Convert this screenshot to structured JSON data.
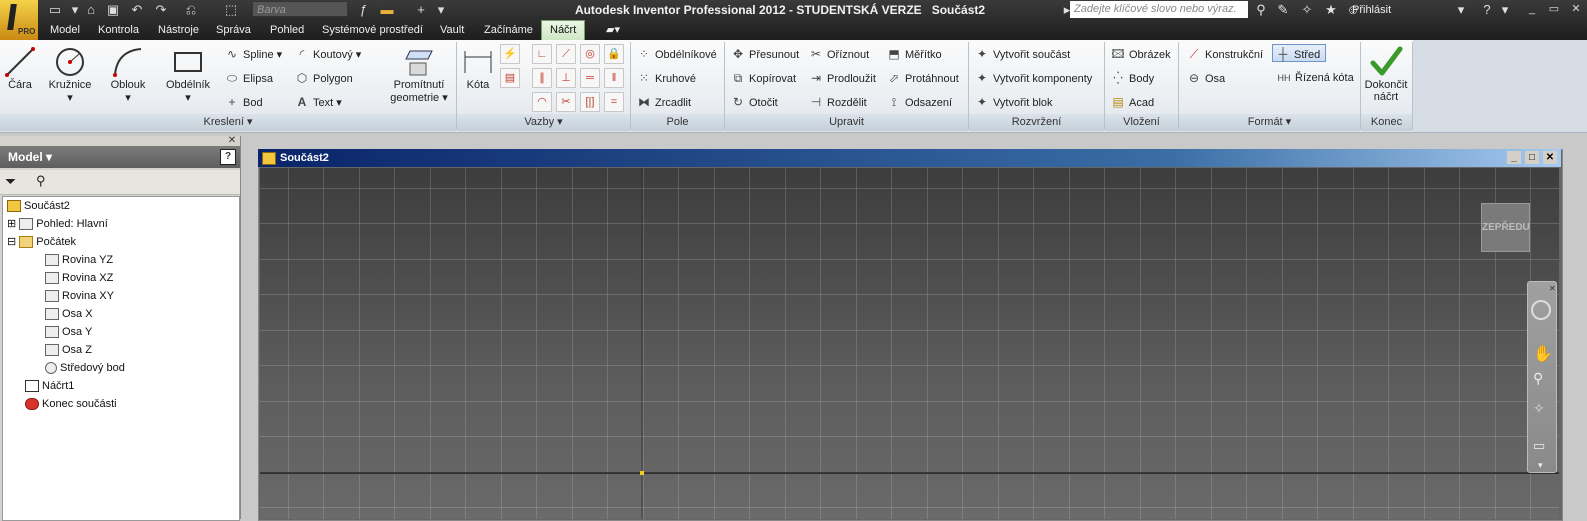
{
  "app": {
    "title": "Autodesk Inventor Professional 2012 - STUDENTSKÁ VERZE",
    "document": "Součást2",
    "pro_badge": "PRO",
    "color_placeholder": "Barva",
    "search_placeholder": "Zadejte klíčové slovo nebo výraz.",
    "signin": "Přihlásit"
  },
  "tabs": [
    "Model",
    "Kontrola",
    "Nástroje",
    "Správa",
    "Pohled",
    "Systémové prostředí",
    "Vault",
    "Začínáme",
    "Náčrt"
  ],
  "active_tab": "Náčrt",
  "ribbon": {
    "kresleni": {
      "title": "Kreslení",
      "cara": "Čára",
      "kruznice": "Kružnice",
      "oblouk": "Oblouk",
      "obdelnik": "Obdélník",
      "spline": "Spline",
      "koutovy": "Koutový",
      "elipsa": "Elipsa",
      "polygon": "Polygon",
      "bod": "Bod",
      "text": "Text",
      "promitnuti_1": "Promítnutí",
      "promitnuti_2": "geometrie"
    },
    "vazby": {
      "title": "Vazby",
      "kota": "Kóta"
    },
    "pole": {
      "title": "Pole",
      "obdelnikove": "Obdélníkové",
      "kruhove": "Kruhové",
      "zrcadlit": "Zrcadlit"
    },
    "upravit": {
      "title": "Upravit",
      "presunout": "Přesunout",
      "kopirovat": "Kopírovat",
      "otocit": "Otočit",
      "oriznout": "Oříznout",
      "prodlouzit": "Prodloužit",
      "rozdelit": "Rozdělit",
      "meritko": "Měřítko",
      "protahnout": "Protáhnout",
      "odsazeni": "Odsazení"
    },
    "rozvrzeni": {
      "title": "Rozvržení",
      "vytvorit_soucast": "Vytvořit součást",
      "vytvorit_komponenty": "Vytvořit komponenty",
      "vytvorit_blok": "Vytvořit blok"
    },
    "vlozeni": {
      "title": "Vložení",
      "obrazek": "Obrázek",
      "body": "Body",
      "acad": "Acad"
    },
    "format": {
      "title": "Formát",
      "konstrukcni": "Konstrukční",
      "osa": "Osa",
      "stred": "Střed",
      "rizena_kota": "Řízená kóta"
    },
    "konec": {
      "title": "Konec",
      "dokoncit_1": "Dokončit",
      "dokoncit_2": "náčrt"
    }
  },
  "browser": {
    "title": "Model",
    "help": "?",
    "tree": [
      {
        "label": "Součást2",
        "indent": 0
      },
      {
        "label": "Pohled: Hlavní",
        "indent": 1
      },
      {
        "label": "Počátek",
        "indent": 1
      },
      {
        "label": "Rovina YZ",
        "indent": 2
      },
      {
        "label": "Rovina XZ",
        "indent": 2
      },
      {
        "label": "Rovina XY",
        "indent": 2
      },
      {
        "label": "Osa X",
        "indent": 2
      },
      {
        "label": "Osa Y",
        "indent": 2
      },
      {
        "label": "Osa Z",
        "indent": 2
      },
      {
        "label": "Středový bod",
        "indent": 2
      },
      {
        "label": "Náčrt1",
        "indent": 1
      },
      {
        "label": "Konec součásti",
        "indent": 1
      }
    ]
  },
  "graphics": {
    "window_title": "Součást2",
    "viewcube_label": "ZEPŘEDU"
  },
  "colors": {
    "accent_green": "#3a9a2a",
    "active_tab_bg": "#d9efcf",
    "title_bar_blue": "#0a246a"
  }
}
